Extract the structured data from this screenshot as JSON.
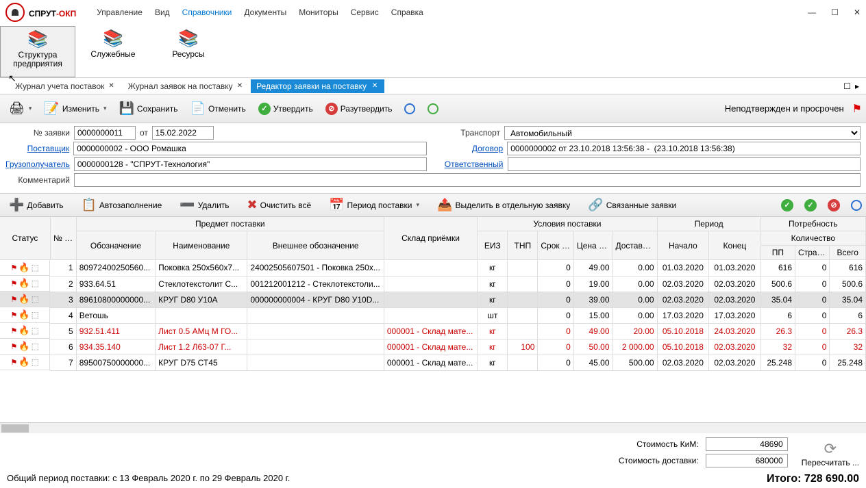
{
  "app": {
    "title1": "СПРУТ",
    "title2": "-ОКП"
  },
  "menu": [
    "Управление",
    "Вид",
    "Справочники",
    "Документы",
    "Мониторы",
    "Сервис",
    "Справка"
  ],
  "menu_active_index": 2,
  "ribbon": [
    {
      "label": "Структура\nпредприятия",
      "icon": "📚",
      "sel": true
    },
    {
      "label": "Служебные",
      "icon": "📚"
    },
    {
      "label": "Ресурсы",
      "icon": "📚"
    }
  ],
  "tabs": [
    {
      "label": "Журнал учета поставок"
    },
    {
      "label": "Журнал заявок на поставку"
    },
    {
      "label": "Редактор заявки на поставку",
      "active": true
    }
  ],
  "toolbar1": {
    "print": "Печать",
    "edit": "Изменить",
    "save": "Сохранить",
    "cancel": "Отменить",
    "approve": "Утвердить",
    "unapprove": "Разутвердить",
    "status_label": "Неподтвержден и просрочен"
  },
  "form": {
    "req_label": "№ заявки",
    "req_value": "0000000011",
    "from_label": "от",
    "from_value": "15.02.2022",
    "supplier_label": "Поставщик",
    "supplier_value": "0000000002 - ООО Ромашка",
    "consignee_label": "Грузополучатель",
    "consignee_value": "0000000128 - \"СПРУТ-Технология\"",
    "comment_label": "Комментарий",
    "comment_value": "",
    "transport_label": "Транспорт",
    "transport_value": "Автомобильный",
    "contract_label": "Договор",
    "contract_value": "0000000002 от 23.10.2018 13:56:38 -  (23.10.2018 13:56:38)",
    "responsible_label": "Ответственный",
    "responsible_value": ""
  },
  "toolbar2": {
    "add": "Добавить",
    "autofill": "Автозаполнение",
    "delete": "Удалить",
    "clear": "Очистить всё",
    "period": "Период поставки",
    "separate": "Выделить в отдельную заявку",
    "related": "Связанные заявки"
  },
  "thead": {
    "status": "Статус",
    "npp": "№ п/п",
    "subject": "Предмет поставки",
    "desig": "Обозначение",
    "name": "Наименование",
    "extdesig": "Внешнее обозначение",
    "warehouse": "Склад приёмки",
    "terms": "Условия поставки",
    "eiz": "ЕИЗ",
    "tnp": "ТНП",
    "leadtime": "Срок поставки, дн.",
    "price": "Цена за ЕИЗ",
    "shipping": "Доставка ТНП",
    "period": "Период",
    "start": "Начало",
    "end": "Конец",
    "need": "Потребность",
    "qty": "Количество",
    "pp": "ПП",
    "safety": "Страховой...",
    "total": "Всего"
  },
  "rows": [
    {
      "n": 1,
      "d": "80972400250560...",
      "nm": "Поковка 250x560x7...",
      "ext": "24002505607501 - Поковка 250x...",
      "wh": "",
      "u": "кг",
      "tnp": "",
      "dn": "0",
      "price": "49.00",
      "ship": "0.00",
      "st": "01.03.2020",
      "en": "01.03.2020",
      "pp": "616",
      "sf": "0",
      "tot": "616"
    },
    {
      "n": 2,
      "d": "933.64.51",
      "nm": "Стеклотекстолит С...",
      "ext": "001212001212 - Стеклотекстоли...",
      "wh": "",
      "u": "кг",
      "tnp": "",
      "dn": "0",
      "price": "19.00",
      "ship": "0.00",
      "st": "02.03.2020",
      "en": "02.03.2020",
      "pp": "500.6",
      "sf": "0",
      "tot": "500.6"
    },
    {
      "n": 3,
      "d": "89610800000000...",
      "nm": "КРУГ D80  У10А",
      "ext": "000000000004 - КРУГ D80  У10D...",
      "wh": "",
      "u": "кг",
      "tnp": "",
      "dn": "0",
      "price": "39.00",
      "ship": "0.00",
      "st": "02.03.2020",
      "en": "02.03.2020",
      "pp": "35.04",
      "sf": "0",
      "tot": "35.04",
      "sel": true
    },
    {
      "n": 4,
      "d": "Ветошь",
      "nm": "",
      "ext": "",
      "wh": "",
      "u": "шт",
      "tnp": "",
      "dn": "0",
      "price": "15.00",
      "ship": "0.00",
      "st": "17.03.2020",
      "en": "17.03.2020",
      "pp": "6",
      "sf": "0",
      "tot": "6"
    },
    {
      "n": 5,
      "d": "932.51.411",
      "nm": "Лист 0.5  АМц М  ГО...",
      "ext": "",
      "wh": "000001 - Склад мате...",
      "u": "кг",
      "tnp": "",
      "dn": "0",
      "price": "49.00",
      "ship": "20.00",
      "st": "05.10.2018",
      "en": "24.03.2020",
      "pp": "26.3",
      "sf": "0",
      "tot": "26.3",
      "red": true
    },
    {
      "n": 6,
      "d": "934.35.140",
      "nm": "Лист 1.2   Л63-07 Г...",
      "ext": "",
      "wh": "000001 - Склад мате...",
      "u": "кг",
      "tnp": "100",
      "dn": "0",
      "price": "50.00",
      "ship": "2 000.00",
      "st": "05.10.2018",
      "en": "02.03.2020",
      "pp": "32",
      "sf": "0",
      "tot": "32",
      "red": true
    },
    {
      "n": 7,
      "d": "89500750000000...",
      "nm": "КРУГ D75  СТ45",
      "ext": "",
      "wh": "000001 - Склад мате...",
      "u": "кг",
      "tnp": "",
      "dn": "0",
      "price": "45.00",
      "ship": "500.00",
      "st": "02.03.2020",
      "en": "02.03.2020",
      "pp": "25.248",
      "sf": "0",
      "tot": "25.248"
    }
  ],
  "footer": {
    "cost_kim": "Стоимость КиМ:",
    "cost_kim_v": "48690",
    "cost_ship": "Стоимость доставки:",
    "cost_ship_v": "680000",
    "recalc": "Пересчитать ...",
    "period": "Общий период поставки: с 13 Февраль 2020 г. по 29 Февраль 2020 г.",
    "total": "Итого: 728 690.00"
  }
}
